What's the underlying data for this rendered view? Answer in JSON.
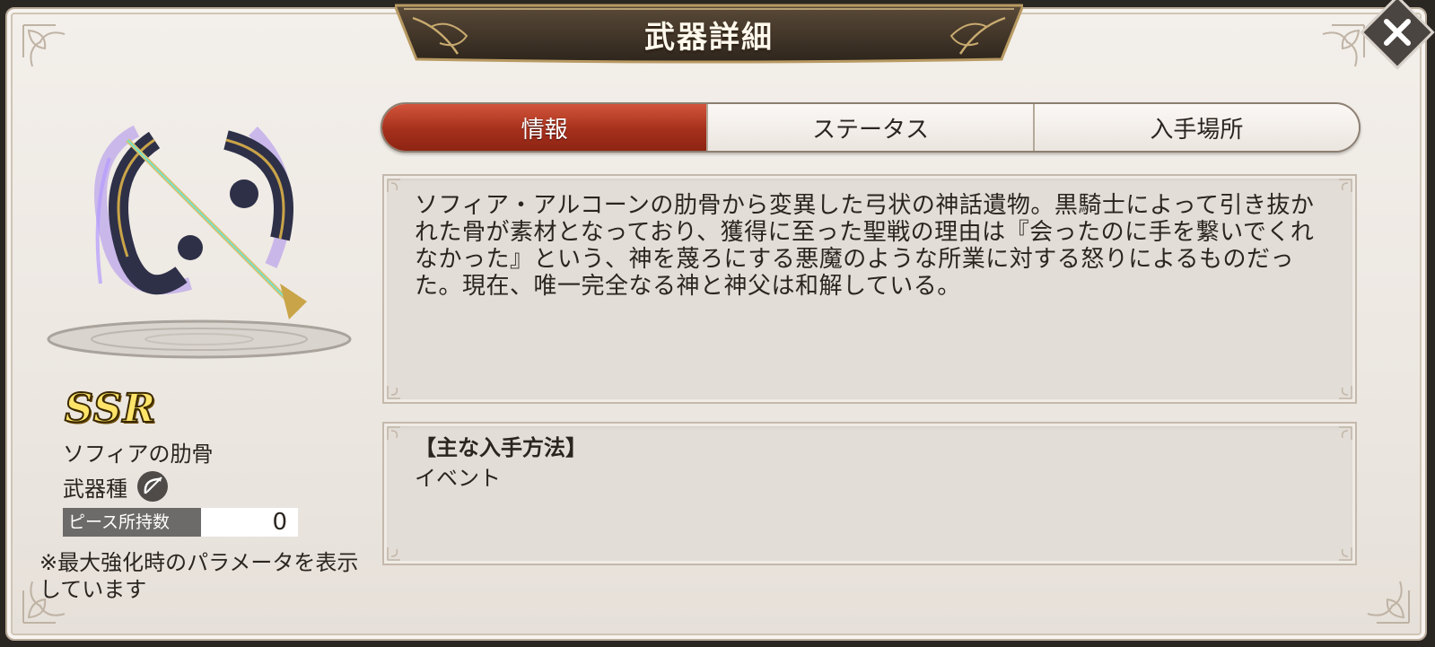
{
  "window": {
    "title": "武器詳細"
  },
  "tabs": [
    {
      "label": "情報",
      "active": true
    },
    {
      "label": "ステータス",
      "active": false
    },
    {
      "label": "入手場所",
      "active": false
    }
  ],
  "weapon": {
    "rarity": "SSR",
    "name": "ソフィアの肋骨",
    "type_label": "武器種",
    "type_icon": "bow-icon",
    "pieces_label": "ピース所持数",
    "pieces_value": "0",
    "note": "※最大強化時のパラメータを表示しています"
  },
  "description": {
    "text": "ソフィア・アルコーンの肋骨から変異した弓状の神話遺物。黒騎士によって引き抜かれた骨が素材となっており、獲得に至った聖戦の理由は『会ったのに手を繋いでくれなかった』という、神を蔑ろにする悪魔のような所業に対する怒りによるものだった。現在、唯一完全なる神と神父は和解している。"
  },
  "obtain": {
    "title": "【主な入手方法】",
    "method": "イベント"
  },
  "colors": {
    "active_tab": "#a5301c",
    "rarity": "#ffe46a",
    "banner": "#3a2f24"
  }
}
